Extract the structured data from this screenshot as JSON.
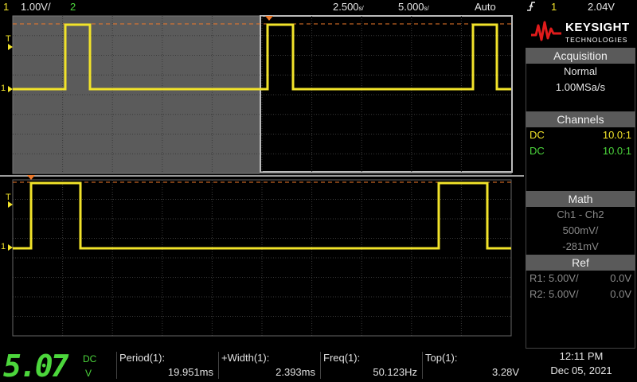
{
  "topbar": {
    "ch1_num": "1",
    "ch1_scale": "1.00V/",
    "ch2_num": "2",
    "time_delay": "2.500",
    "time_delay_unit": "s/",
    "time_scale": "5.000",
    "time_scale_unit": "s/",
    "trigger_mode": "Auto",
    "trigger_icon": "rising-edge-icon",
    "trigger_source": "1",
    "trigger_level": "2.04V"
  },
  "brand": {
    "name": "KEYSIGHT",
    "sub": "TECHNOLOGIES"
  },
  "acquisition": {
    "header": "Acquisition",
    "mode": "Normal",
    "rate": "1.00MSa/s"
  },
  "channels": {
    "header": "Channels",
    "rows": [
      {
        "coupling": "DC",
        "probe": "10.0:1",
        "color": "#f2e32a"
      },
      {
        "coupling": "DC",
        "probe": "10.0:1",
        "color": "#4cd63c"
      }
    ]
  },
  "math": {
    "header": "Math",
    "function": "Ch1 - Ch2",
    "scale": "500mV/",
    "offset": "-281mV"
  },
  "ref": {
    "header": "Ref",
    "rows": [
      {
        "name": "R1:",
        "scale": "5.00V/",
        "offset": "0.0V"
      },
      {
        "name": "R2:",
        "scale": "5.00V/",
        "offset": "0.0V"
      }
    ]
  },
  "dvm": {
    "value": "5.07",
    "coupling": "DC",
    "unit": "V"
  },
  "measurements": [
    {
      "label": "Period(1):",
      "value": "19.951ms"
    },
    {
      "label": "+Width(1):",
      "value": "2.393ms"
    },
    {
      "label": "Freq(1):",
      "value": "50.123Hz"
    },
    {
      "label": "Top(1):",
      "value": "3.28V"
    }
  ],
  "clock": {
    "time": "12:11 PM",
    "date": "Dec 05, 2021"
  },
  "markers": {
    "trigger_level_label": "T",
    "ground_label": "1"
  },
  "colors": {
    "ch1": "#f2e32a",
    "ch2": "#4cd63c",
    "trigger_line": "#f07a2a",
    "grid": "#3a3a3a",
    "zoom_window": "#6b6b6b"
  }
}
